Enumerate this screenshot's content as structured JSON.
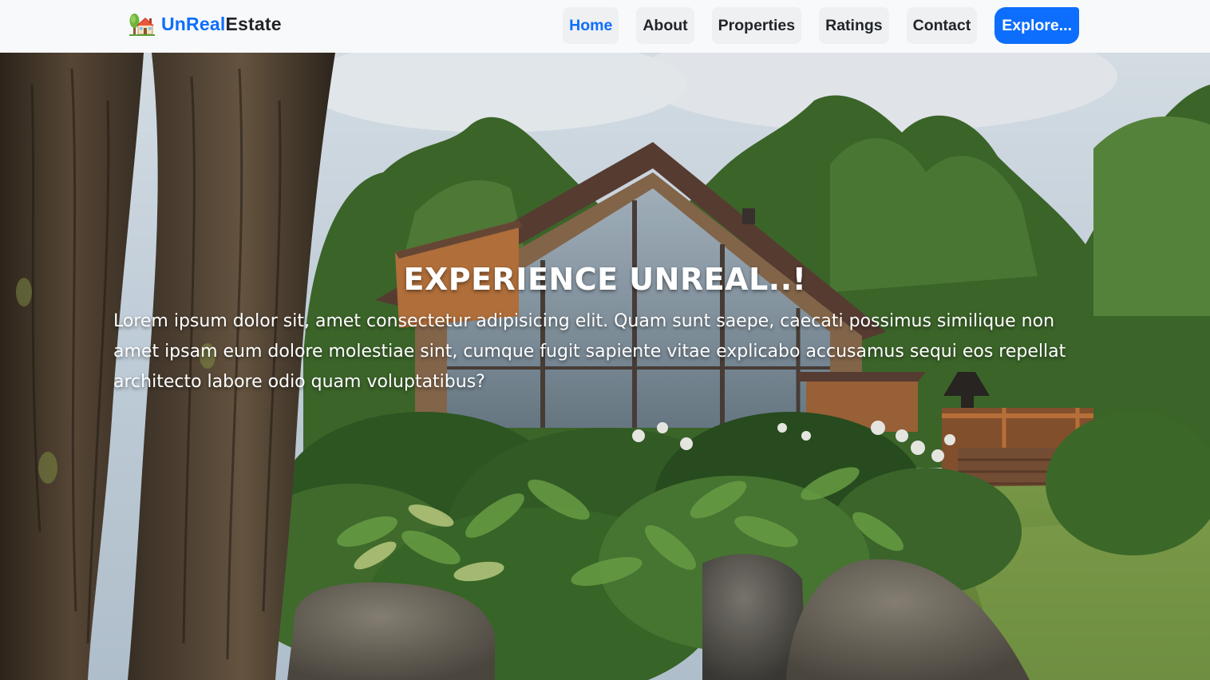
{
  "brand": {
    "name_part_1": "UnReal",
    "name_part_2": "Estate",
    "icon": "house-tree-icon",
    "color_primary": "#0d6efd",
    "color_dark": "#212529"
  },
  "nav": {
    "items": [
      {
        "label": "Home",
        "active": true
      },
      {
        "label": "About",
        "active": false
      },
      {
        "label": "Properties",
        "active": false
      },
      {
        "label": "Ratings",
        "active": false
      },
      {
        "label": "Contact",
        "active": false
      }
    ],
    "cta_label": "Explore..."
  },
  "hero": {
    "title": "EXPERIENCE UNREAL..!",
    "text": "Lorem ipsum dolor sit, amet consectetur adipisicing elit. Quam sunt saepe, caecati possimus similique non amet ipsam eum dolore molestiae sint, cumque fugit sapiente vitae explicabo accusamus sequi eos repellat architecto labore odio quam voluptatibus?"
  }
}
